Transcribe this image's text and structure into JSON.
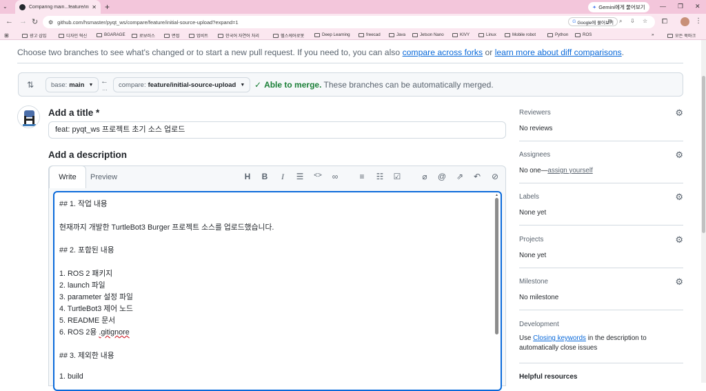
{
  "browser": {
    "tab_title": "Comparing main...feature/initi...",
    "gemini_label": "Gemini에게 물어보기",
    "url": "github.com/hsmaster/pyqt_ws/compare/feature/initial-source-upload?expand=1",
    "google_button": "Google에 물어보기",
    "bookmarks": [
      "광고 삽입",
      "디자인 혁신",
      "BGARAGE",
      "로보러스",
      "면접",
      "업비트",
      "한국어 자연어 처리",
      "헬스케어로봇",
      "Deep Learning",
      "freecad",
      "Java",
      "Jetson Nano",
      "KIVY",
      "Linux",
      "Mobile robot",
      "Python",
      "ROS"
    ],
    "all_bookmarks": "모든 북마크"
  },
  "compare": {
    "intro_text": "Choose two branches to see what's changed or to start a new pull request. If you need to, you can also",
    "intro_link1": "compare across forks",
    "intro_or": "or",
    "intro_link2": "learn more about diff comparisons",
    "intro_end": ".",
    "base_label": "base:",
    "base_value": "main",
    "compare_label": "compare:",
    "compare_value": "feature/initial-source-upload",
    "merge_status": "Able to merge.",
    "merge_detail": "These branches can be automatically merged."
  },
  "form": {
    "title_heading": "Add a title *",
    "title_value": "feat: pyqt_ws 프로젝트 초기 소스 업로드",
    "desc_heading": "Add a description",
    "tab_write": "Write",
    "tab_preview": "Preview",
    "description_lines": [
      "## 1. 작업 내용",
      "",
      "현재까지 개발한 TurtleBot3 Burger 프로젝트 소스를 업로드했습니다.",
      "",
      "## 2. 포함된 내용",
      "",
      "1. ROS 2 패키지",
      "2. launch 파일",
      "3. parameter 설정 파일",
      "4. TurtleBot3 제어 노드",
      "5. README 문서",
      "6. ROS 2용 .gitignore",
      "",
      "## 3. 제외한 내용",
      "",
      "1. build"
    ]
  },
  "sidebar": {
    "reviewers": {
      "title": "Reviewers",
      "value": "No reviews"
    },
    "assignees": {
      "title": "Assignees",
      "value": "No one—",
      "link": "assign yourself"
    },
    "labels": {
      "title": "Labels",
      "value": "None yet"
    },
    "projects": {
      "title": "Projects",
      "value": "None yet"
    },
    "milestone": {
      "title": "Milestone",
      "value": "No milestone"
    },
    "development": {
      "title": "Development",
      "pre": "Use",
      "link": "Closing keywords",
      "post": "in the description to",
      "line2": "automatically close issues"
    },
    "helpful": {
      "title": "Helpful resources"
    }
  }
}
